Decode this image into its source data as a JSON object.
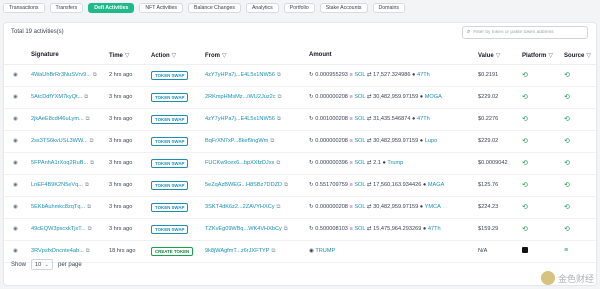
{
  "tabs": [
    {
      "label": "Transactions",
      "active": false
    },
    {
      "label": "Transfers",
      "active": false
    },
    {
      "label": "Defi Activities",
      "active": true
    },
    {
      "label": "NFT Activities",
      "active": false
    },
    {
      "label": "Balance Changes",
      "active": false
    },
    {
      "label": "Analytics",
      "active": false
    },
    {
      "label": "Portfolio",
      "active": false
    },
    {
      "label": "Stake Accounts",
      "active": false
    },
    {
      "label": "Domains",
      "active": false
    }
  ],
  "summary": {
    "total": "Total 19 activities(s)"
  },
  "search": {
    "placeholder": "Filter by token or paste token address"
  },
  "columns": {
    "signature": "Signature",
    "time": "Time",
    "action": "Action",
    "from": "From",
    "amount": "Amount",
    "value": "Value",
    "platform": "Platform",
    "source": "Source"
  },
  "filter_glyph": "▽",
  "rows": [
    {
      "signature": "4WaUhBrRr3NuSVrv9...",
      "time": "2 hrs ago",
      "action": "TOKEN SWAP",
      "from": "4zY7yHPa7j...E4L5x1NW56",
      "amount_a": "0.000955293",
      "token_a": "SOL",
      "amount_b": "17,527.324986",
      "token_b": "47Th",
      "value": "$0.2191"
    },
    {
      "signature": "5AtcDdfYXM7kyQt...",
      "time": "3 hrs ago",
      "action": "TOKEN SWAP",
      "from": "2RKmpHMsMz...iWU2Juz2c",
      "amount_a": "0.000000208",
      "token_a": "SOL",
      "amount_b": "30,482,959.97159",
      "token_b": "MOGA",
      "value": "$229.02"
    },
    {
      "signature": "2jkAeE8cdt46uLym...",
      "time": "3 hrs ago",
      "action": "TOKEN SWAP",
      "from": "4zY7yHPa7j...E4L5x1NW56",
      "amount_a": "0.001000208",
      "token_a": "SOL",
      "amount_b": "31,435.546874",
      "token_b": "47Th",
      "value": "$0.2276"
    },
    {
      "signature": "2ss3TS6kvUSL3WW...",
      "time": "3 hrs ago",
      "action": "TOKEN SWAP",
      "from": "BqFrXN7xP...8kef9ngWm",
      "amount_a": "0.000000208",
      "token_a": "SOL",
      "amount_b": "30,482,959.97159",
      "token_b": "Lupo",
      "value": "$229.02"
    },
    {
      "signature": "5FPAnhA1rXoq2RuB...",
      "time": "3 hrs ago",
      "action": "TOKEN SWAP",
      "from": "FUCKw9cex6...bpXXfzDJxx",
      "amount_a": "0.000000396",
      "token_a": "SOL",
      "amount_b": "2.1",
      "token_b": "Trump",
      "value": "$0.0009042"
    },
    {
      "signature": "LnEF4B9K2N5eVq...",
      "time": "3 hrs ago",
      "action": "TOKEN SWAP",
      "from": "5eZqAzBWEG...H8SBz7DDZD",
      "amount_a": "0.551709759",
      "token_a": "SOL",
      "amount_b": "17,560,163.934426",
      "token_b": "MAGA",
      "value": "$125.76"
    },
    {
      "signature": "5EKbAuhmkc8zqTq...",
      "time": "3 hrs ago",
      "action": "TOKEN SWAP",
      "from": "3SKT4dK6z2...2ZAVYHXCy",
      "amount_a": "0.000000208",
      "token_a": "SOL",
      "amount_b": "30,482,959.97159",
      "token_b": "YMCA",
      "value": "$224.23"
    },
    {
      "signature": "49cEQW3pscxkTjxT...",
      "time": "3 hrs ago",
      "action": "TOKEN SWAP",
      "from": "TZKvEg09WBq...WK4VHXbCy",
      "amount_a": "0.500008103",
      "token_a": "SOL",
      "amount_b": "15,475,964.293269",
      "token_b": "47Th",
      "value": "$159.29"
    },
    {
      "signature": "3RVpsfxDncnte4ab...",
      "time": "18 hrs ago",
      "action": "CREATE TOKEN",
      "from": "9k8jWAgfmT...z6rJXFTYP",
      "amount_a": "",
      "token_a": "",
      "amount_b": "",
      "token_b": "TRUMP",
      "value": "N/A"
    }
  ],
  "footer": {
    "show": "Show",
    "page_size": "10",
    "per_page": "per page"
  },
  "watermark": "金色财经"
}
